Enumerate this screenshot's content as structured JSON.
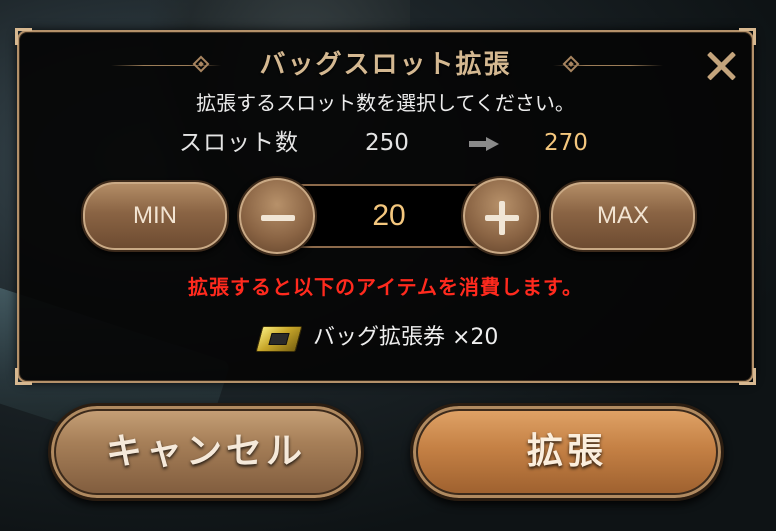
{
  "dialog": {
    "title": "バッグスロット拡張",
    "subtitle": "拡張するスロット数を選択してください。",
    "slots": {
      "label": "スロット数",
      "current": "250",
      "after": "270"
    },
    "stepper": {
      "min_label": "MIN",
      "value": "20",
      "max_label": "MAX"
    },
    "warning": "拡張すると以下のアイテムを消費します。",
    "cost_item": {
      "label": "バッグ拡張券 ×20",
      "icon": "ticket-icon"
    }
  },
  "buttons": {
    "cancel_label": "キャンセル",
    "expand_label": "拡張"
  },
  "colors": {
    "accent_gold": "#f4c77e",
    "warning_red": "#ff2a1e",
    "border_bronze": "#b4916a"
  }
}
